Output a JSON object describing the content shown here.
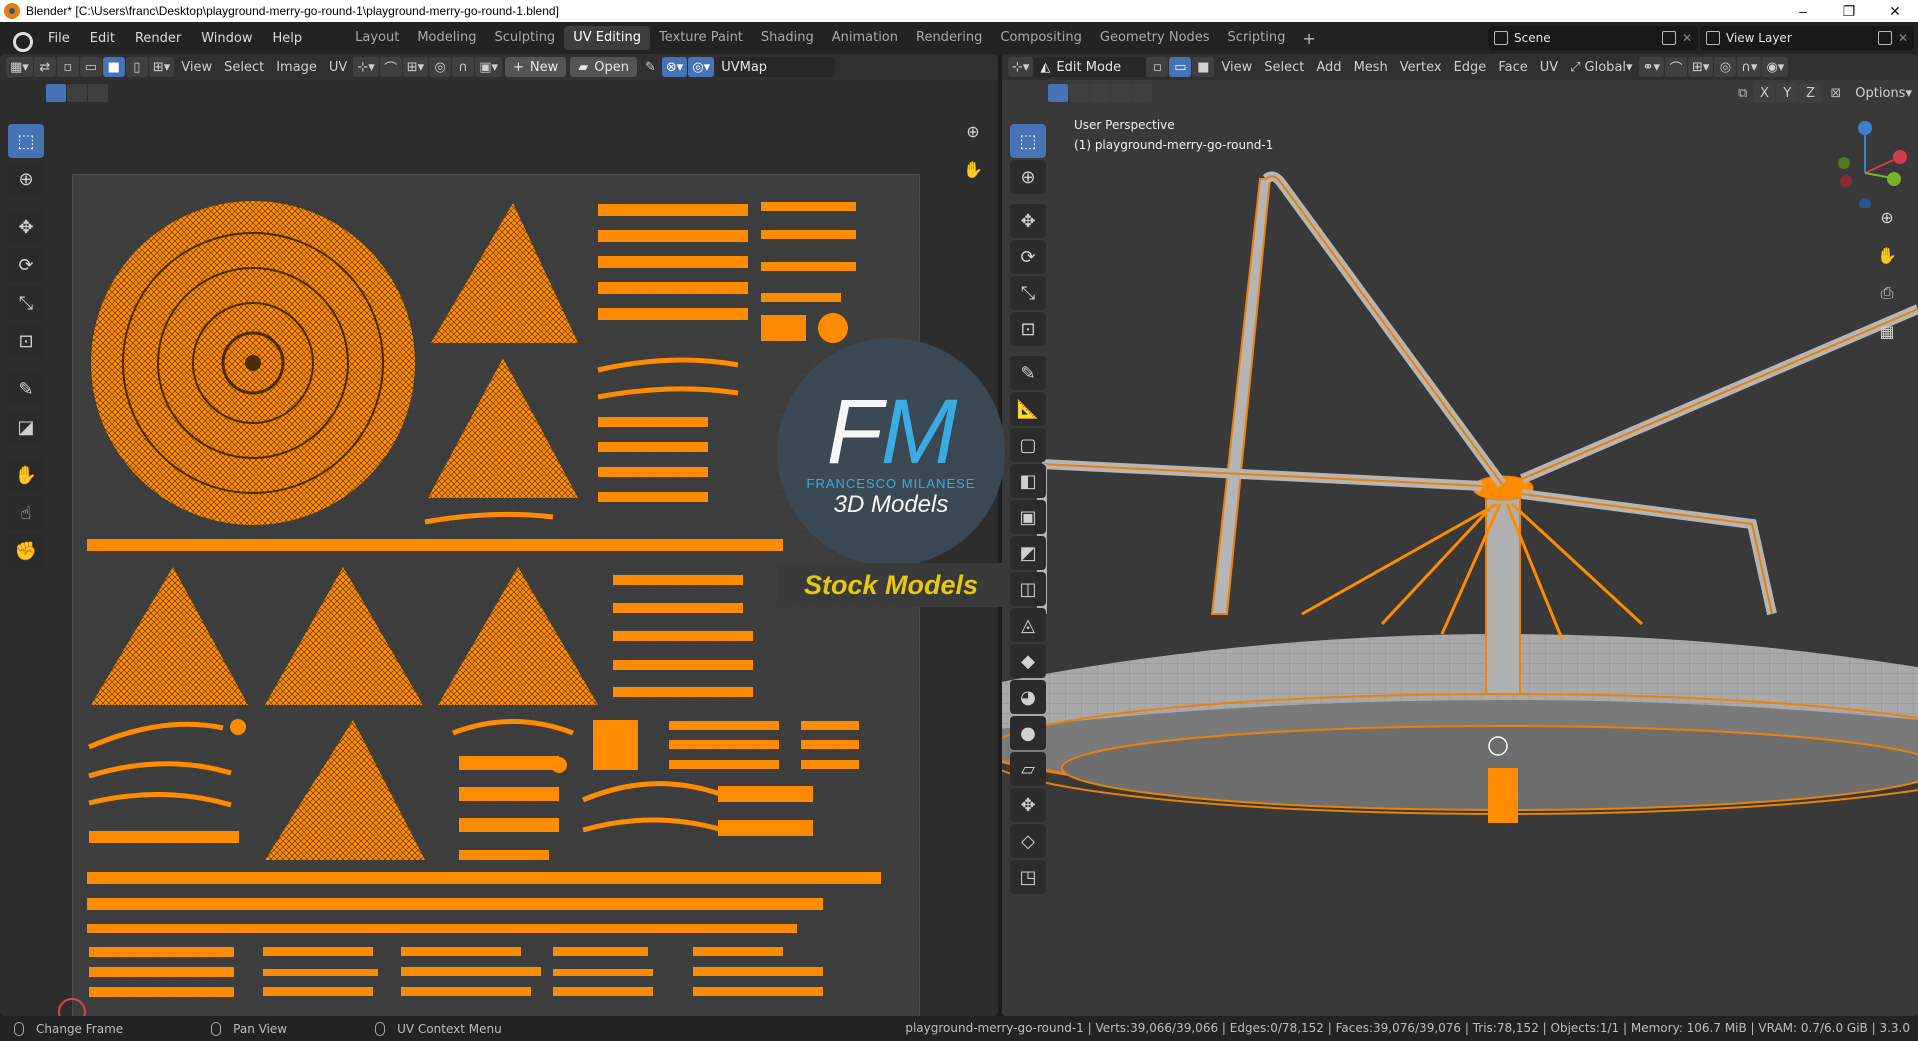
{
  "window": {
    "title": "Blender* [C:\\Users\\franc\\Desktop\\playground-merry-go-round-1\\playground-merry-go-round-1.blend]",
    "controls": {
      "minimize": "–",
      "maximize": "❐",
      "close": "✕"
    }
  },
  "menu": [
    "File",
    "Edit",
    "Render",
    "Window",
    "Help"
  ],
  "workspaces": [
    {
      "label": "Layout",
      "active": false
    },
    {
      "label": "Modeling",
      "active": false
    },
    {
      "label": "Sculpting",
      "active": false
    },
    {
      "label": "UV Editing",
      "active": true
    },
    {
      "label": "Texture Paint",
      "active": false
    },
    {
      "label": "Shading",
      "active": false
    },
    {
      "label": "Animation",
      "active": false
    },
    {
      "label": "Rendering",
      "active": false
    },
    {
      "label": "Compositing",
      "active": false
    },
    {
      "label": "Geometry Nodes",
      "active": false
    },
    {
      "label": "Scripting",
      "active": false
    }
  ],
  "add_workspace": "+",
  "scene": {
    "name": "Scene"
  },
  "view_layer": {
    "name": "View Layer"
  },
  "uv_editor": {
    "menus": [
      "View",
      "Select",
      "Image",
      "UV"
    ],
    "new_label": "New",
    "open_label": "Open",
    "uv_map": "UVMap",
    "plus": "+"
  },
  "viewport": {
    "mode": "Edit Mode",
    "menus": [
      "View",
      "Select",
      "Add",
      "Mesh",
      "Vertex",
      "Edge",
      "Face",
      "UV"
    ],
    "orientation": "Global",
    "axes": [
      "X",
      "Y",
      "Z"
    ],
    "options_label": "Options",
    "perspective_label": "User Perspective",
    "object_label": "(1) playground-merry-go-round-1"
  },
  "watermark": {
    "letter_f": "F",
    "letter_m": "M",
    "name": "FRANCESCO MILANESE",
    "subtitle": "3D Models",
    "banner": "Stock Models"
  },
  "status": {
    "items": [
      "Change Frame",
      "Pan View",
      "UV Context Menu"
    ],
    "stats": "playground-merry-go-round-1 | Verts:39,066/39,066 | Edges:0/78,152 | Faces:39,076/39,076 | Tris:78,152 | Objects:1/1 | Memory: 106.7 MiB | VRAM: 0.7/6.0 GiB | 3.3.0"
  },
  "colors": {
    "accent": "#4772b3",
    "uv_orange": "#ff8c00",
    "edit_orange": "#e8820a",
    "watermark_blue": "#3bb1e8",
    "banner_yellow": "#e8c80c"
  }
}
